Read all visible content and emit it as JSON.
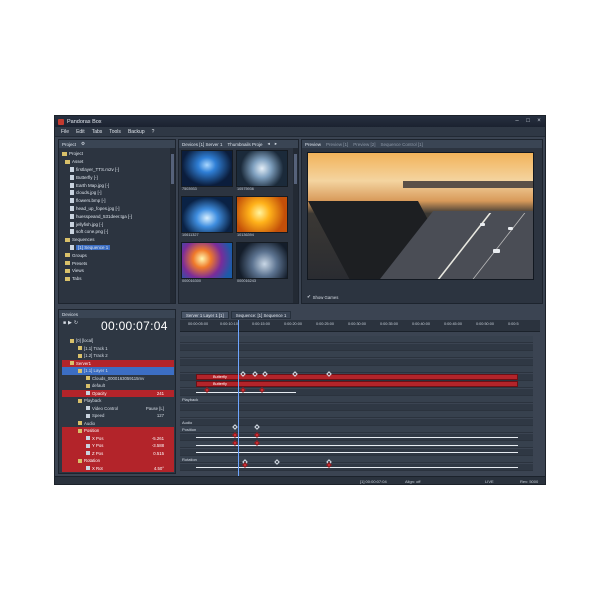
{
  "window": {
    "title": "Pandoras Box"
  },
  "menu": [
    "File",
    "Edit",
    "Tabs",
    "Tools",
    "Backup",
    "?"
  ],
  "project_panel": {
    "header": "Project",
    "items": [
      {
        "label": "Project",
        "type": "root"
      },
      {
        "label": "Asset",
        "type": "folder"
      },
      {
        "label": "firstlayer_TTS.m2v [-]",
        "type": "file"
      },
      {
        "label": "Butterfly [-]",
        "type": "file"
      },
      {
        "label": "Earth Map.jpg [-]",
        "type": "file"
      },
      {
        "label": "clouds.jpg [-]",
        "type": "file"
      },
      {
        "label": "flowers.bmp [-]",
        "type": "file"
      },
      {
        "label": "head_up_fopes.jpg [-]",
        "type": "file"
      },
      {
        "label": "huesspeand_531deer.tga [-]",
        "type": "file"
      },
      {
        "label": "jellyfish.jpg [-]",
        "type": "file"
      },
      {
        "label": "soft cone.png [-]",
        "type": "file"
      },
      {
        "label": "Sequences",
        "type": "folder"
      },
      {
        "label": "[1] Sequence 1",
        "type": "file",
        "selected": true
      },
      {
        "label": "Groups",
        "type": "folder"
      },
      {
        "label": "Presets",
        "type": "folder"
      },
      {
        "label": "Views",
        "type": "folder"
      },
      {
        "label": "Tabs",
        "type": "folder"
      }
    ]
  },
  "thumb_panel": {
    "tabs": [
      "Devices [1] Server 1",
      "Thumbnails Proje"
    ],
    "thumbs": [
      {
        "label": "7503933"
      },
      {
        "label": "10575936"
      },
      {
        "label": "10611327"
      },
      {
        "label": "10136394"
      },
      {
        "label": "000016300"
      },
      {
        "label": "000016243"
      }
    ]
  },
  "preview_panel": {
    "tabs": [
      "Preview",
      "Preview [1]",
      "Preview [2]",
      "Sequence Control [1]"
    ],
    "show_games_label": "Show Games"
  },
  "devices_panel": {
    "header": "Devices"
  },
  "timecode": "00:00:07:04",
  "timeline": {
    "tabs": [
      "Server 1 Layer 1 [1]",
      "Sequence: [1] Sequence 1"
    ],
    "ruler": [
      "00:00:05:00",
      "0:00:10:10",
      "0:00:15:00",
      "0:00:20:00",
      "0:00:25:00",
      "0:00:30:00",
      "0:00:35:00",
      "0:00:40:00",
      "0:00:45:00",
      "0:00:50:00",
      "0:00:5"
    ],
    "bar_label": "Butterfly",
    "lane_labels": {
      "playback": "Playback",
      "audio": "Audio",
      "position": "Position",
      "rotation": "Rotation"
    }
  },
  "properties": [
    {
      "label": "[0] [local]",
      "value": "",
      "style": "normal",
      "indent": 1
    },
    {
      "label": "[1.1] Track 1",
      "value": "",
      "style": "normal",
      "indent": 2
    },
    {
      "label": "[1.2] Track 2",
      "value": "",
      "style": "normal",
      "indent": 2
    },
    {
      "label": "Server1",
      "value": "",
      "style": "red",
      "indent": 1
    },
    {
      "label": "[1.1] Layer 1",
      "value": "",
      "style": "blue",
      "indent": 2
    },
    {
      "label": "Clouds_0000163059115mv",
      "value": "",
      "style": "normal",
      "indent": 3
    },
    {
      "label": "default",
      "value": "",
      "style": "normal",
      "indent": 3
    },
    {
      "label": "Opacity",
      "value": "241",
      "style": "red",
      "indent": 3
    },
    {
      "label": "Playback",
      "value": "",
      "style": "normal",
      "indent": 2
    },
    {
      "label": "Video Control",
      "value": "Pause [L]",
      "style": "normal",
      "indent": 3
    },
    {
      "label": "Speed",
      "value": "127",
      "style": "normal",
      "indent": 3
    },
    {
      "label": "Audio",
      "value": "",
      "style": "normal",
      "indent": 2
    },
    {
      "label": "Position",
      "value": "",
      "style": "red",
      "indent": 2
    },
    {
      "label": "X Pos",
      "value": "-5.261",
      "style": "red",
      "indent": 3
    },
    {
      "label": "Y Pos",
      "value": "-3.588",
      "style": "red",
      "indent": 3
    },
    {
      "label": "Z Pos",
      "value": "0.515",
      "style": "red",
      "indent": 3
    },
    {
      "label": "Rotation",
      "value": "",
      "style": "red",
      "indent": 2
    },
    {
      "label": "X Rot",
      "value": "4.50°",
      "style": "red",
      "indent": 3
    }
  ],
  "statusbar": {
    "timecode": "[1] 00:00:07:04",
    "align": "Align: off",
    "mode": "LIVE",
    "rev": "Rev: 5000"
  },
  "colors": {
    "accent_red": "#b3242a",
    "selection_blue": "#3c6ec4",
    "window_bg": "#3b4452"
  }
}
